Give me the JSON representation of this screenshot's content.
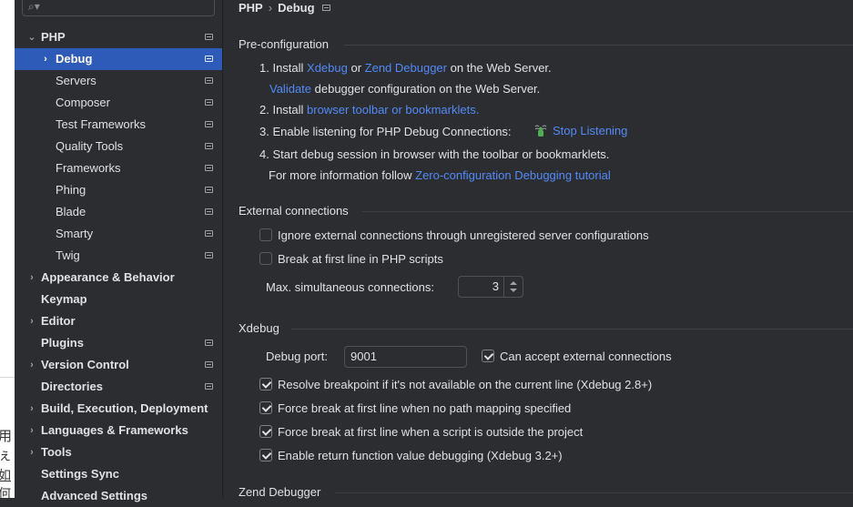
{
  "background_chars": [
    "用ぇ",
    "如何"
  ],
  "sidebar": {
    "search_placeholder": "",
    "items": [
      {
        "label": "PHP",
        "expanded": true
      },
      {
        "label": "Debug",
        "selected": true
      },
      {
        "label": "Servers"
      },
      {
        "label": "Composer"
      },
      {
        "label": "Test Frameworks"
      },
      {
        "label": "Quality Tools"
      },
      {
        "label": "Frameworks"
      },
      {
        "label": "Phing"
      },
      {
        "label": "Blade"
      },
      {
        "label": "Smarty"
      },
      {
        "label": "Twig"
      },
      {
        "label": "Appearance & Behavior"
      },
      {
        "label": "Keymap"
      },
      {
        "label": "Editor"
      },
      {
        "label": "Plugins"
      },
      {
        "label": "Version Control"
      },
      {
        "label": "Directories"
      },
      {
        "label": "Build, Execution, Deployment"
      },
      {
        "label": "Languages & Frameworks"
      },
      {
        "label": "Tools"
      },
      {
        "label": "Settings Sync"
      },
      {
        "label": "Advanced Settings"
      }
    ]
  },
  "breadcrumb": {
    "parent": "PHP",
    "separator": "›",
    "current": "Debug"
  },
  "preconfig": {
    "title": "Pre-configuration",
    "step1_prefix": "1. Install ",
    "xdebug_link": "Xdebug",
    "or": " or ",
    "zend_link": "Zend Debugger",
    "step1_suffix": " on the Web Server.",
    "validate_link": "Validate",
    "validate_suffix": " debugger configuration on the Web Server.",
    "step2_prefix": "2. Install ",
    "bookmarklets_link": "browser toolbar or bookmarklets.",
    "step3": "3. Enable listening for PHP Debug Connections:",
    "stop_listening_link": "Stop Listening",
    "step4": "4. Start debug session in browser with the toolbar or bookmarklets.",
    "more_info_prefix": "For more information follow ",
    "tutorial_link": "Zero-configuration Debugging tutorial"
  },
  "external": {
    "title": "External connections",
    "ignore_label": "Ignore external connections through unregistered server configurations",
    "ignore_checked": false,
    "break_label": "Break at first line in PHP scripts",
    "break_checked": false,
    "max_label": "Max. simultaneous connections:",
    "max_value": "3"
  },
  "xdebug": {
    "title": "Xdebug",
    "port_label": "Debug port:",
    "port_value": "9001",
    "accept_label": "Can accept external connections",
    "accept_checked": true,
    "resolve_label": "Resolve breakpoint if it's not available on the current line (Xdebug 2.8+)",
    "resolve_checked": true,
    "force_nomap_label": "Force break at first line when no path mapping specified",
    "force_nomap_checked": true,
    "force_outside_label": "Force break at first line when a script is outside the project",
    "force_outside_checked": true,
    "return_label": "Enable return function value debugging (Xdebug 3.2+)",
    "return_checked": true
  },
  "zend": {
    "title": "Zend Debugger"
  },
  "colors": {
    "accent": "#548af7",
    "selection": "#2e5bb8",
    "background": "#2b2d30"
  }
}
